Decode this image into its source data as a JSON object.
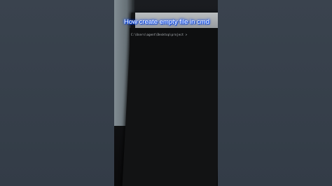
{
  "video": {
    "caption": "How create empty file in cmd",
    "prompt_text": "C:\\Users\\agent\\Desktop\\project >"
  },
  "colors": {
    "background": "#2f3742",
    "caption_glow": "#1a5cff",
    "caption_text": "#ffffff"
  }
}
